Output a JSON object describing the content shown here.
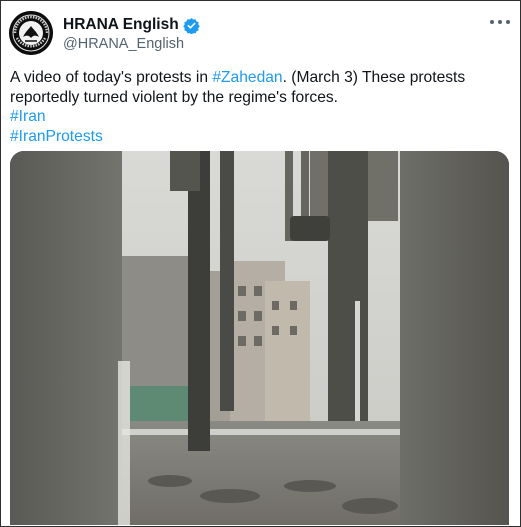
{
  "tweet": {
    "author": {
      "display_name": "HRANA English",
      "handle": "@HRANA_English",
      "verified": true,
      "avatar_icon": "hrana-logo-avatar"
    },
    "more_icon": "more-horizontal-icon",
    "text": {
      "line1_prefix": "A video of today's protests in ",
      "line1_link": "#Zahedan",
      "line1_suffix": ". (March 3) These protests",
      "line2": "reportedly turned violent by the regime's forces.",
      "hashtag1": "#Iran",
      "hashtag2": "#IranProtests"
    },
    "media": {
      "type": "video",
      "description_icon": "video-frame"
    }
  },
  "colors": {
    "link": "#1d9bf0",
    "text": "#0f1419",
    "secondary": "#536471",
    "verified": "#1d9bf0"
  }
}
